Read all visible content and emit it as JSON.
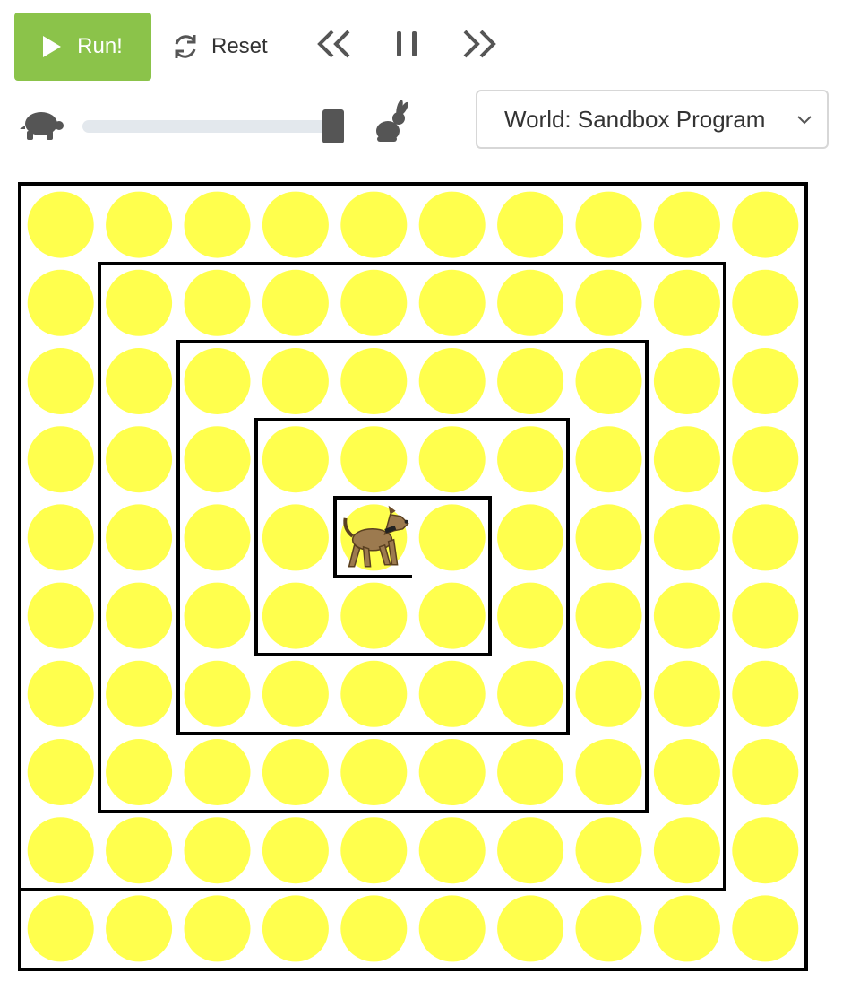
{
  "toolbar": {
    "run_label": "Run!",
    "reset_label": "Reset",
    "colors": {
      "run_bg": "#8bc34a",
      "icon": "#555555"
    }
  },
  "speed": {
    "slow_icon": "turtle-icon",
    "fast_icon": "rabbit-icon",
    "level": 1.0
  },
  "world_select": {
    "value": "World: Sandbox Program"
  },
  "world": {
    "cols": 10,
    "rows": 10,
    "ball_color": "#ffff4d",
    "dog_cell": {
      "col": 4,
      "row": 4
    },
    "character_icon": "dog-icon"
  }
}
